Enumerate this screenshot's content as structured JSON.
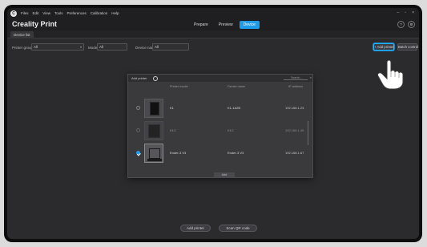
{
  "menubar": {
    "items": [
      "Files",
      "Edit",
      "View",
      "Tools",
      "Preferences",
      "Calibration",
      "Help"
    ],
    "window_controls": [
      "–",
      "▫",
      "×"
    ]
  },
  "titlebar": {
    "app_title": "Creality Print",
    "tabs": [
      {
        "label": "Prepare",
        "active": false
      },
      {
        "label": "Preview",
        "active": false
      },
      {
        "label": "Device",
        "active": true
      }
    ],
    "right_icons": [
      "?",
      "⚙"
    ]
  },
  "tabstrip": {
    "tab_label": "Device list"
  },
  "filters": {
    "printer_group_label": "Printer group",
    "printer_group_value": "All",
    "model_label": "Model",
    "model_value": "All",
    "name_label": "Device name",
    "name_value": "All"
  },
  "top_buttons": {
    "add_label": "+ Add printer",
    "batch_label": "Batch control"
  },
  "dialog": {
    "title": "Add printer",
    "search_placeholder": "Search…",
    "columns": {
      "model": "Printer model",
      "name": "Device name",
      "ip": "IP address"
    },
    "rows": [
      {
        "model": "K1",
        "name": "K1-1A2B",
        "ip": "192.168.1.23",
        "checked": false,
        "dim": false
      },
      {
        "model": "K1C",
        "name": "K1C",
        "ip": "192.168.1.45",
        "checked": false,
        "dim": true
      },
      {
        "model": "Ender-3 V3",
        "name": "Ender-3 V3",
        "ip": "192.168.1.67",
        "checked": true,
        "dim": false
      }
    ],
    "add_button": "Add"
  },
  "bottom_buttons": {
    "left_label": "Add printer",
    "right_label": "Scan QR code"
  },
  "colors": {
    "accent": "#1e9be9",
    "highlight_border": "#25b4ff",
    "background": "#2b2b2e"
  }
}
